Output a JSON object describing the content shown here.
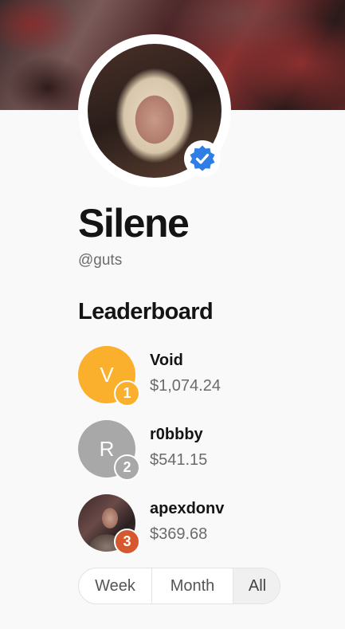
{
  "profile": {
    "name": "Silene",
    "handle": "@guts",
    "verified": true
  },
  "leaderboard": {
    "title": "Leaderboard",
    "entries": [
      {
        "rank": "1",
        "initial": "V",
        "name": "Void",
        "amount": "$1,074.24",
        "avatar_color": "#fbb02d",
        "rank_color": "#fbb02d"
      },
      {
        "rank": "2",
        "initial": "R",
        "name": "r0bbby",
        "amount": "$541.15",
        "avatar_color": "#a8a8a8",
        "rank_color": "#a8a8a8"
      },
      {
        "rank": "3",
        "initial": "",
        "name": "apexdonv",
        "amount": "$369.68",
        "avatar_color": "#5a4040",
        "rank_color": "#d6582e"
      }
    ]
  },
  "period_filter": {
    "options": [
      "Week",
      "Month",
      "All"
    ],
    "selected": "All"
  },
  "icons": {
    "verified": "verified-badge-icon"
  },
  "colors": {
    "verified_blue": "#2f7ee6",
    "gold": "#fbb02d",
    "silver": "#a8a8a8",
    "bronze": "#d6582e"
  }
}
